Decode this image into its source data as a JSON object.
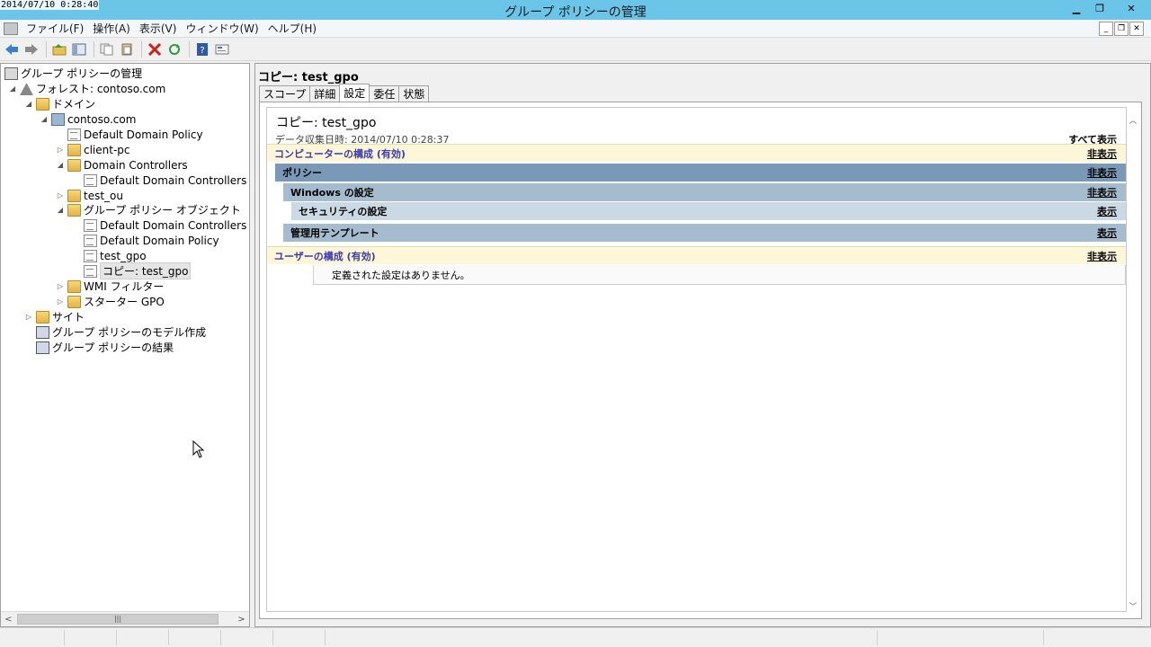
{
  "window": {
    "clock": "2014/07/10 0:28:40",
    "title": "グループ ポリシーの管理",
    "minimize": "▁",
    "maximize": "❐",
    "close": "✕"
  },
  "menu": {
    "items": [
      "ファイル(F)",
      "操作(A)",
      "表示(V)",
      "ウィンドウ(W)",
      "ヘルプ(H)"
    ]
  },
  "tree": {
    "root": "グループ ポリシーの管理",
    "forest": "フォレスト: contoso.com",
    "domains": "ドメイン",
    "domain": "contoso.com",
    "default_domain_policy": "Default Domain Policy",
    "client_pc": "client-pc",
    "domain_controllers": "Domain Controllers",
    "ddc_policy_link": "Default Domain Controllers Po",
    "test_ou": "test_ou",
    "gpo_objects": "グループ ポリシー オブジェクト",
    "gpo_ddc": "Default Domain Controllers Po",
    "gpo_ddp": "Default Domain Policy",
    "gpo_test": "test_gpo",
    "gpo_copy": "コピー: test_gpo",
    "wmi": "WMI フィルター",
    "starter": "スターター GPO",
    "sites": "サイト",
    "modeling": "グループ ポリシーのモデル作成",
    "results": "グループ ポリシーの結果"
  },
  "right": {
    "header": "コピー: test_gpo",
    "tabs": [
      "スコープ",
      "詳細",
      "設定",
      "委任",
      "状態"
    ],
    "active_tab": 2
  },
  "report": {
    "title": "コピー: test_gpo",
    "date": "データ収集日時: 2014/07/10 0:28:37",
    "show_all": "すべて表示",
    "computer_config": "コンピューターの構成 (有効)",
    "computer_action": "非表示",
    "policy": "ポリシー",
    "policy_action": "非表示",
    "windows_settings": "Windows の設定",
    "windows_action": "非表示",
    "security_settings": "セキュリティの設定",
    "security_action": "表示",
    "admin_templates": "管理用テンプレート",
    "admin_action": "表示",
    "user_config": "ユーザーの構成 (有効)",
    "user_action": "非表示",
    "no_settings": "定義された設定はありません。"
  },
  "colors": {
    "titlebar": "#6bc5e8",
    "section_head": "#fef6d8",
    "level1": "#7a99b6",
    "level2": "#a5bccf",
    "level3": "#cbd9e4",
    "section_text": "#3b3bb3"
  }
}
